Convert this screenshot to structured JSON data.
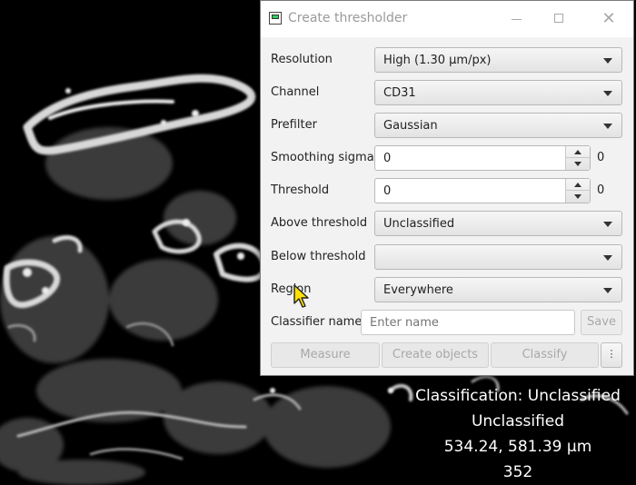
{
  "dialog": {
    "title": "Create thresholder",
    "rows": {
      "resolution": {
        "label": "Resolution",
        "value": "High (1.30 µm/px)"
      },
      "channel": {
        "label": "Channel",
        "value": "CD31"
      },
      "prefilter": {
        "label": "Prefilter",
        "value": "Gaussian"
      },
      "smoothing": {
        "label": "Smoothing sigma",
        "value": "0",
        "extra": "0"
      },
      "threshold": {
        "label": "Threshold",
        "value": "0",
        "extra": "0"
      },
      "above": {
        "label": "Above threshold",
        "value": "Unclassified"
      },
      "below": {
        "label": "Below threshold",
        "value": ""
      },
      "region": {
        "label": "Region",
        "value": "Everywhere"
      }
    },
    "classifier_name": {
      "label": "Classifier name",
      "placeholder": "Enter name",
      "save": "Save"
    },
    "actions": {
      "measure": "Measure",
      "create_objects": "Create objects",
      "classify": "Classify",
      "more": "⋮"
    }
  },
  "overlay": {
    "classification": "Classification: Unclassified",
    "class_name": "Unclassified",
    "coords": "534.24, 581.39 µm",
    "value": "352"
  },
  "icons": {
    "cursor": "arrow-cursor-icon",
    "app": "app-icon"
  },
  "colors": {
    "cursor": "#ffe000",
    "dialog_bg": "#f2f2f2",
    "viewer_bg": "#000000"
  }
}
